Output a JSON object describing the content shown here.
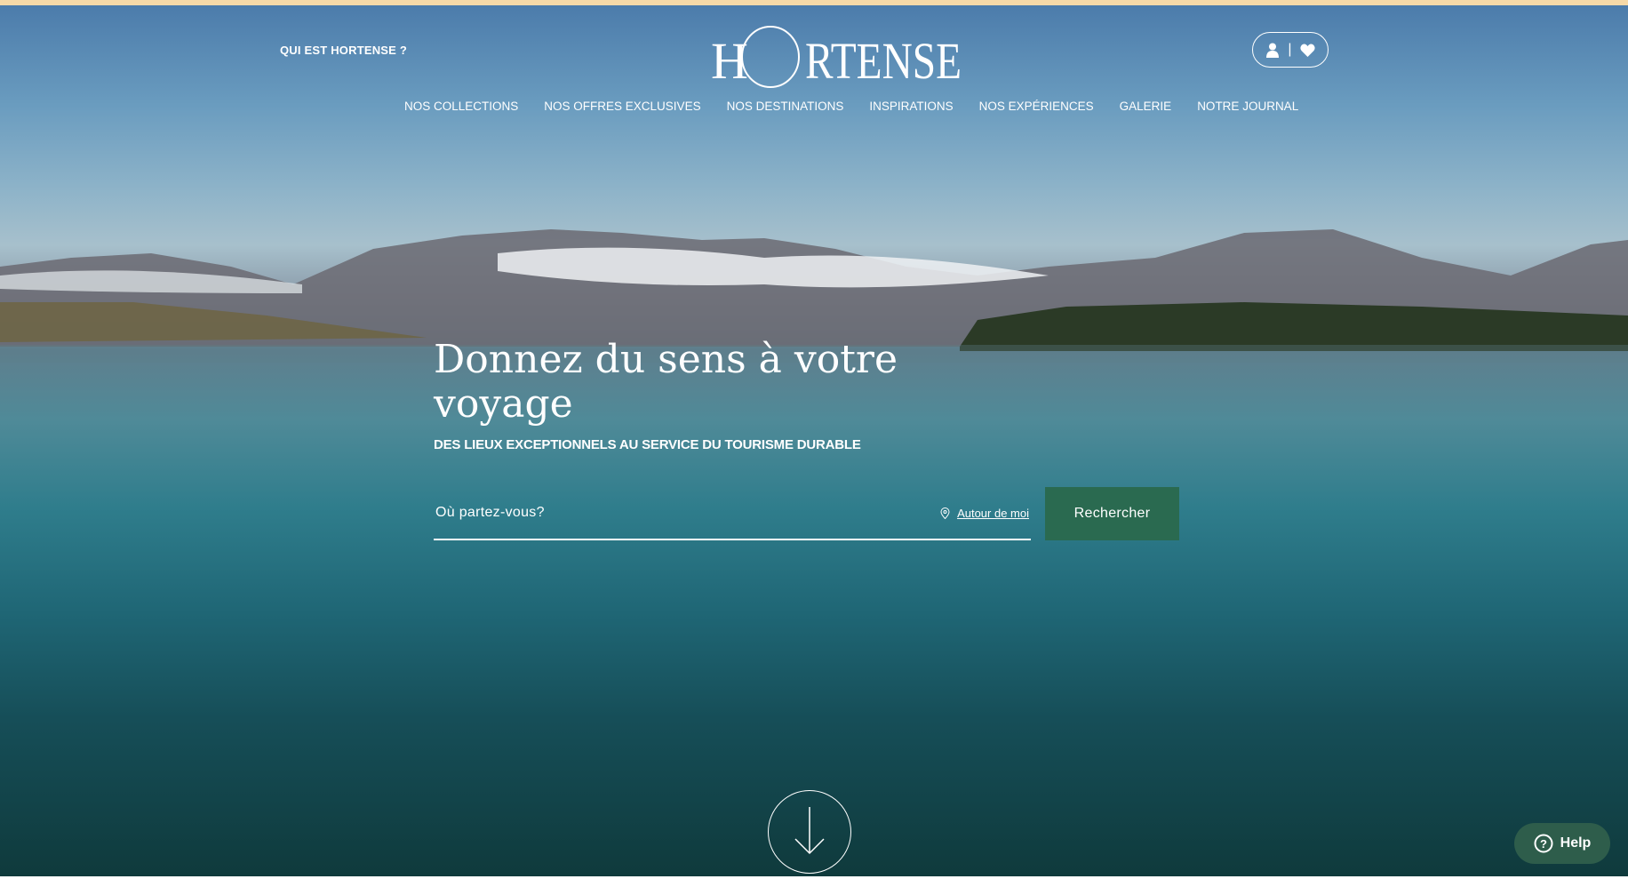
{
  "header": {
    "about_link": "QUI EST HORTENSE ?",
    "logo": "HORTENSE",
    "account_icon": "user-icon",
    "favorites_icon": "heart-icon",
    "separator": "|"
  },
  "nav": [
    {
      "label": "NOS COLLECTIONS"
    },
    {
      "label": "NOS OFFRES EXCLUSIVES"
    },
    {
      "label": "NOS DESTINATIONS"
    },
    {
      "label": "INSPIRATIONS"
    },
    {
      "label": "NOS EXPÉRIENCES"
    },
    {
      "label": "GALERIE"
    },
    {
      "label": "NOTRE JOURNAL"
    }
  ],
  "hero": {
    "title": "Donnez du sens à votre voyage",
    "subtitle": "DES LIEUX EXCEPTIONNELS AU SERVICE DU TOURISME DURABLE"
  },
  "search": {
    "placeholder": "Où partez-vous?",
    "near_me": "Autour de moi",
    "button": "Rechercher"
  },
  "help": {
    "label": "Help"
  },
  "colors": {
    "accent": "#2a6a50",
    "help_bg": "#2e5d4b",
    "top_bar": "#f6d9a8"
  }
}
